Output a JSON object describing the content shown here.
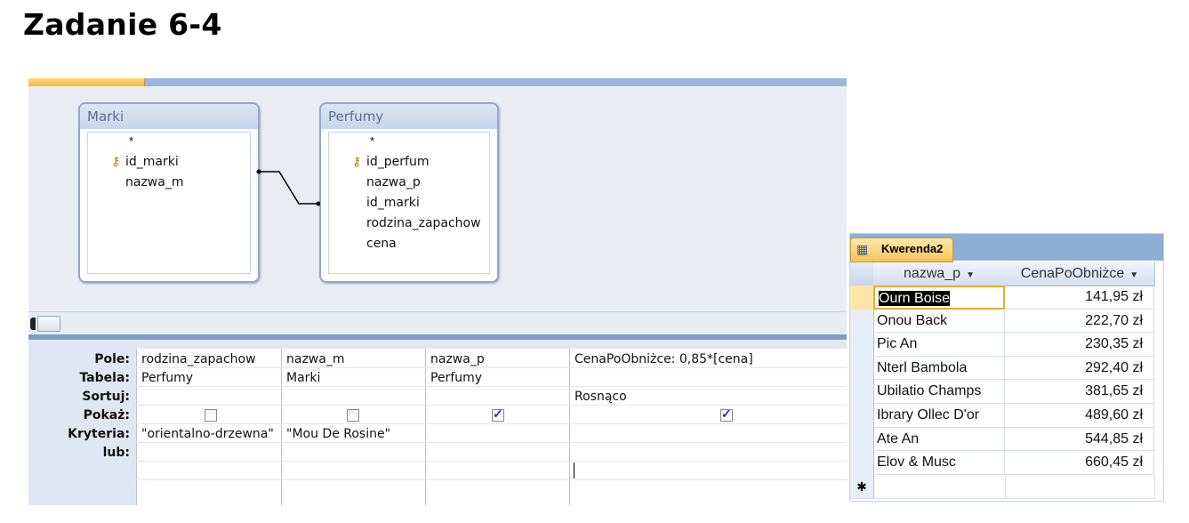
{
  "title": "Zadanie 6-4",
  "tables": [
    {
      "name": "Marki",
      "fields": [
        "*",
        "id_marki",
        "nazwa_m"
      ],
      "key_field": "id_marki"
    },
    {
      "name": "Perfumy",
      "fields": [
        "*",
        "id_perfum",
        "nazwa_p",
        "id_marki",
        "rodzina_zapachow",
        "cena"
      ],
      "key_field": "id_perfum"
    }
  ],
  "grid": {
    "row_labels": [
      "Pole:",
      "Tabela:",
      "Sortuj:",
      "Pokaż:",
      "Kryteria:",
      "lub:"
    ],
    "columns": [
      {
        "field": "rodzina_zapachow",
        "table": "Perfumy",
        "sort": "",
        "show": false,
        "criteria": "\"orientalno-drzewna\""
      },
      {
        "field": "nazwa_m",
        "table": "Marki",
        "sort": "",
        "show": false,
        "criteria": "\"Mou De Rosine\""
      },
      {
        "field": "nazwa_p",
        "table": "Perfumy",
        "sort": "",
        "show": true,
        "criteria": ""
      },
      {
        "field": "CenaPoObniżce: 0,85*[cena]",
        "table": "",
        "sort": "Rosnąco",
        "show": true,
        "criteria": ""
      }
    ]
  },
  "datasheet": {
    "tab_label": "Kwerenda2",
    "headers": [
      "nazwa_p",
      "CenaPoObniżce"
    ],
    "rows": [
      [
        "Ourn Boise",
        "141,95 zł"
      ],
      [
        "Onou Back",
        "222,70 zł"
      ],
      [
        "Pic An",
        "230,35 zł"
      ],
      [
        "Nterl Bambola",
        "292,40 zł"
      ],
      [
        "Ubilatio Champs",
        "381,65 zł"
      ],
      [
        "Ibrary Ollec D'or",
        "489,60 zł"
      ],
      [
        "Ate An",
        "544,85 zł"
      ],
      [
        "Elov & Musc",
        "660,45 zł"
      ]
    ],
    "new_row_marker": "✱"
  },
  "icons": {
    "key": "key-icon",
    "dropdown": "dropdown-arrow-icon",
    "table": "table-icon"
  },
  "colors": {
    "accent_blue": "#8faed6",
    "tab_orange": "#f6c35a",
    "selection": "#000000"
  }
}
